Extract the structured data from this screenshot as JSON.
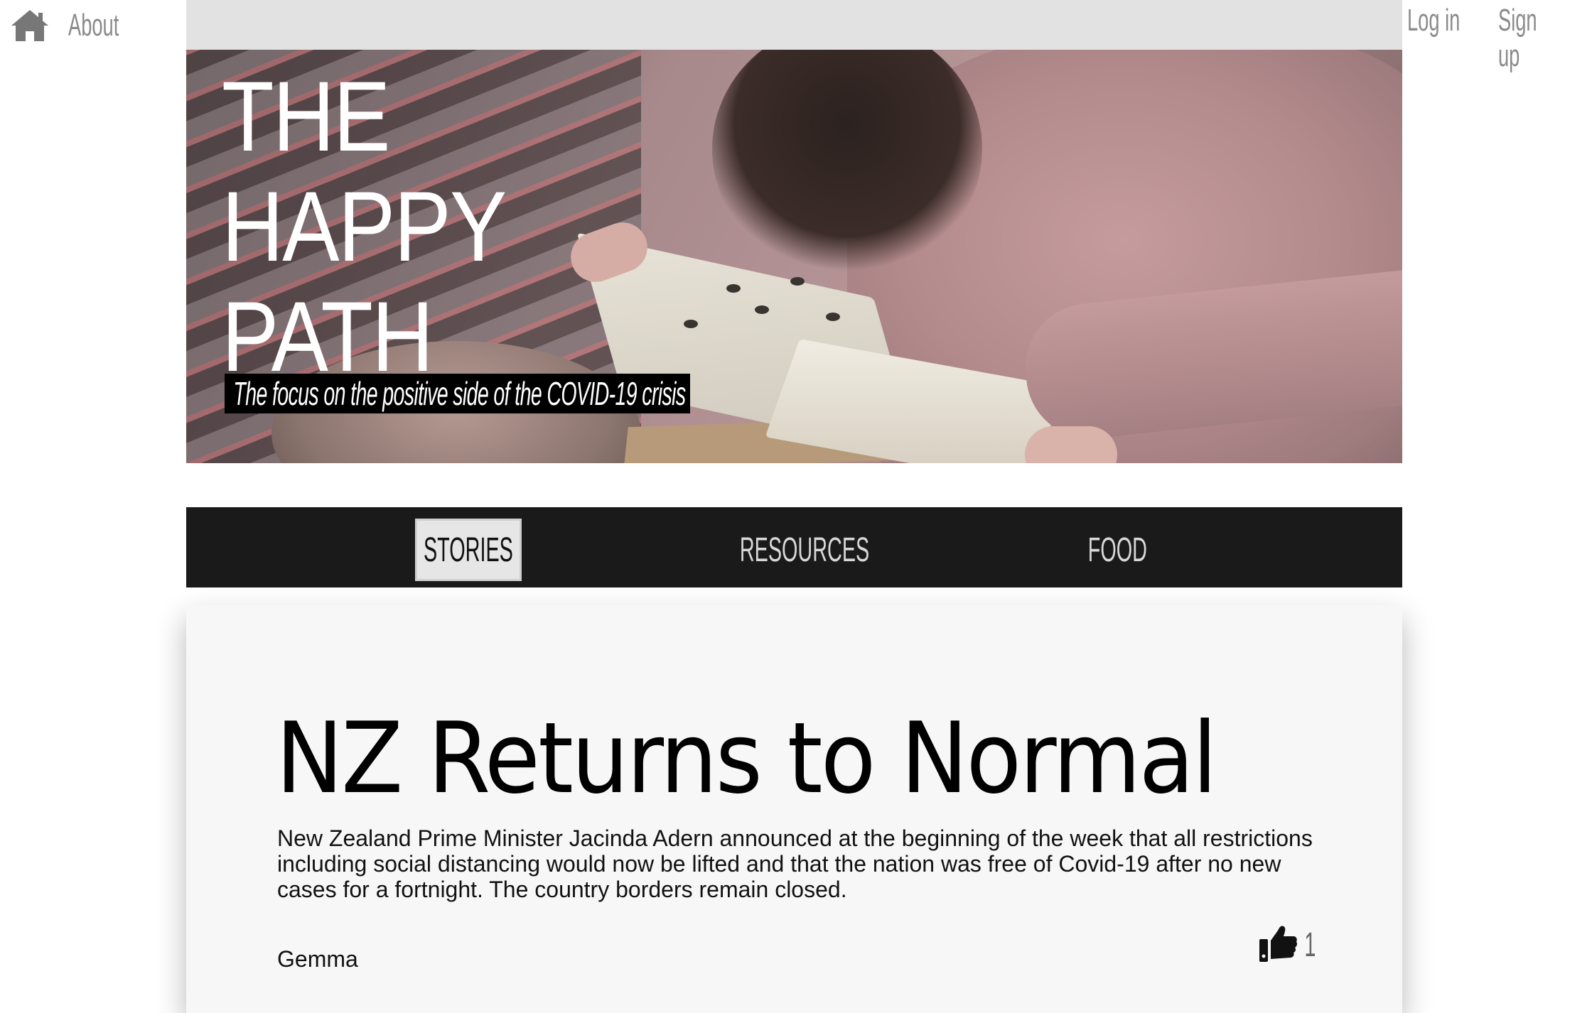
{
  "topbar": {
    "home_icon": "home-icon",
    "about_label": "About",
    "login_label": "Log in",
    "signup_label": "Sign up"
  },
  "hero": {
    "title_lines": [
      "THE",
      "HAPPY",
      "PATH"
    ],
    "tagline": "The focus on the positive side of the COVID-19 crisis"
  },
  "nav": {
    "tabs": [
      {
        "label": "STORIES",
        "active": true
      },
      {
        "label": "RESOURCES",
        "active": false
      },
      {
        "label": "FOOD",
        "active": false
      }
    ]
  },
  "story": {
    "title": "NZ Returns to Normal",
    "body": "New Zealand Prime Minister Jacinda Adern announced at the beginning of the week that all restrictions including social distancing would now be lifted and that the nation was free of Covid-19 after no new cases for a fortnight. The country borders remain closed.",
    "author": "Gemma",
    "like_icon": "thumbs-up-icon",
    "likes": "1"
  },
  "colors": {
    "nav_bg": "#1a1a1a",
    "active_tab_bg": "#e6e6e6",
    "card_bg": "#f7f7f7",
    "link_grey": "#8a8a8a"
  }
}
